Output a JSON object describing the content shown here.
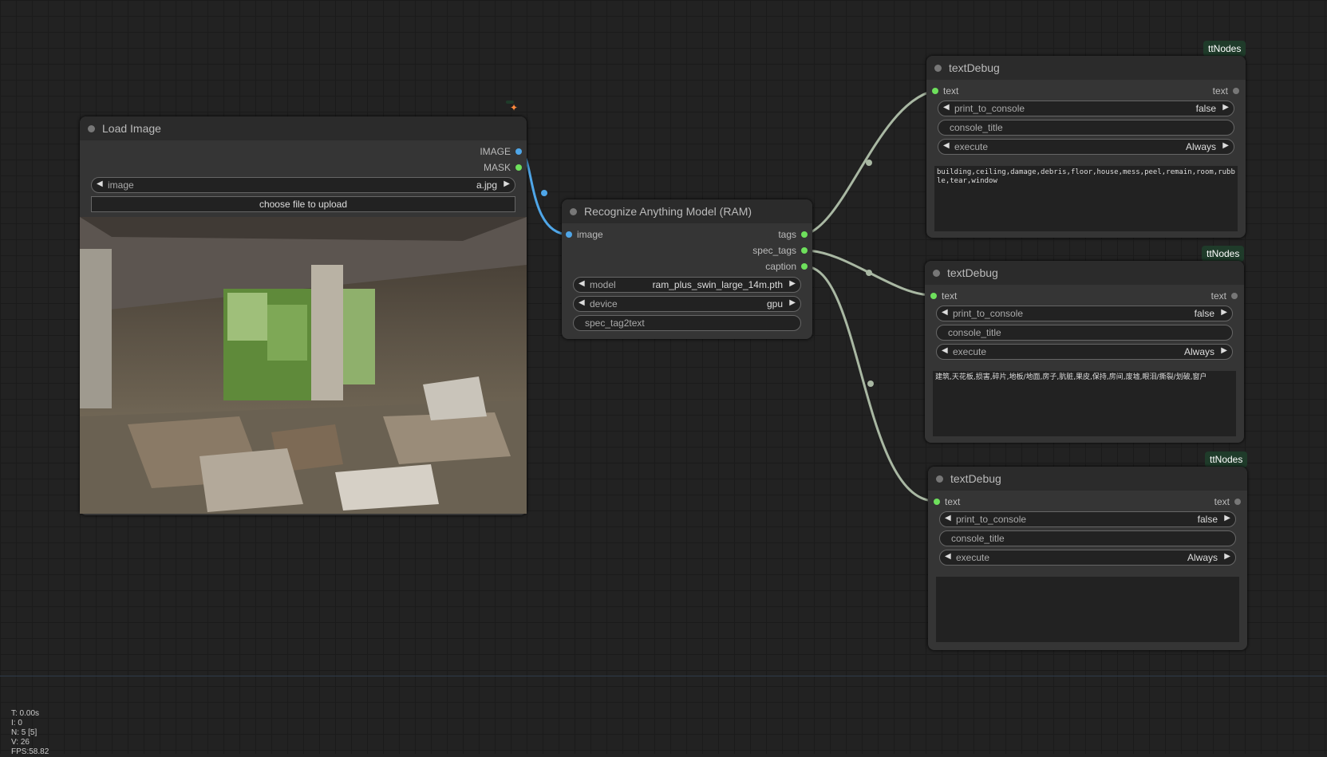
{
  "load_image": {
    "title": "Load Image",
    "badge_icon": "fox-icon",
    "outputs": [
      "IMAGE",
      "MASK"
    ],
    "image_widget": {
      "label": "image",
      "value": "a.jpg"
    },
    "upload_button": "choose file to upload",
    "preview_icon": "destroyed-room-photo"
  },
  "ram": {
    "title": "Recognize Anything Model (RAM)",
    "input": "image",
    "outputs": [
      "tags",
      "spec_tags",
      "caption"
    ],
    "model": {
      "label": "model",
      "value": "ram_plus_swin_large_14m.pth"
    },
    "device": {
      "label": "device",
      "value": "gpu"
    },
    "spec_tag2text": "spec_tag2text"
  },
  "text_debug_nodes": [
    {
      "badge": "ttNodes",
      "title": "textDebug",
      "input": "text",
      "output": "text",
      "print_to_console": {
        "label": "print_to_console",
        "value": "false"
      },
      "console_title": "console_title",
      "execute": {
        "label": "execute",
        "value": "Always"
      },
      "text": "building,ceiling,damage,debris,floor,house,mess,peel,remain,room,rubble,tear,window"
    },
    {
      "badge": "ttNodes",
      "title": "textDebug",
      "input": "text",
      "output": "text",
      "print_to_console": {
        "label": "print_to_console",
        "value": "false"
      },
      "console_title": "console_title",
      "execute": {
        "label": "execute",
        "value": "Always"
      },
      "text": "建筑,天花板,损害,碎片,地板/地面,房子,肮脏,果皮,保持,房间,废墟,眼泪/撕裂/划破,窗户"
    },
    {
      "badge": "ttNodes",
      "title": "textDebug",
      "input": "text",
      "output": "text",
      "print_to_console": {
        "label": "print_to_console",
        "value": "false"
      },
      "console_title": "console_title",
      "execute": {
        "label": "execute",
        "value": "Always"
      },
      "text": ""
    }
  ],
  "stats": {
    "t": "T: 0.00s",
    "i": "I: 0",
    "n": "N: 5 [5]",
    "v": "V: 26",
    "fps": "FPS:58.82"
  },
  "colors": {
    "image_link": "#4fa6e8",
    "text_link": "#a9b8a3",
    "slot_green": "#6ee05c",
    "slot_blue": "#4fa6e8",
    "badge_bg": "#1f3b2a"
  }
}
